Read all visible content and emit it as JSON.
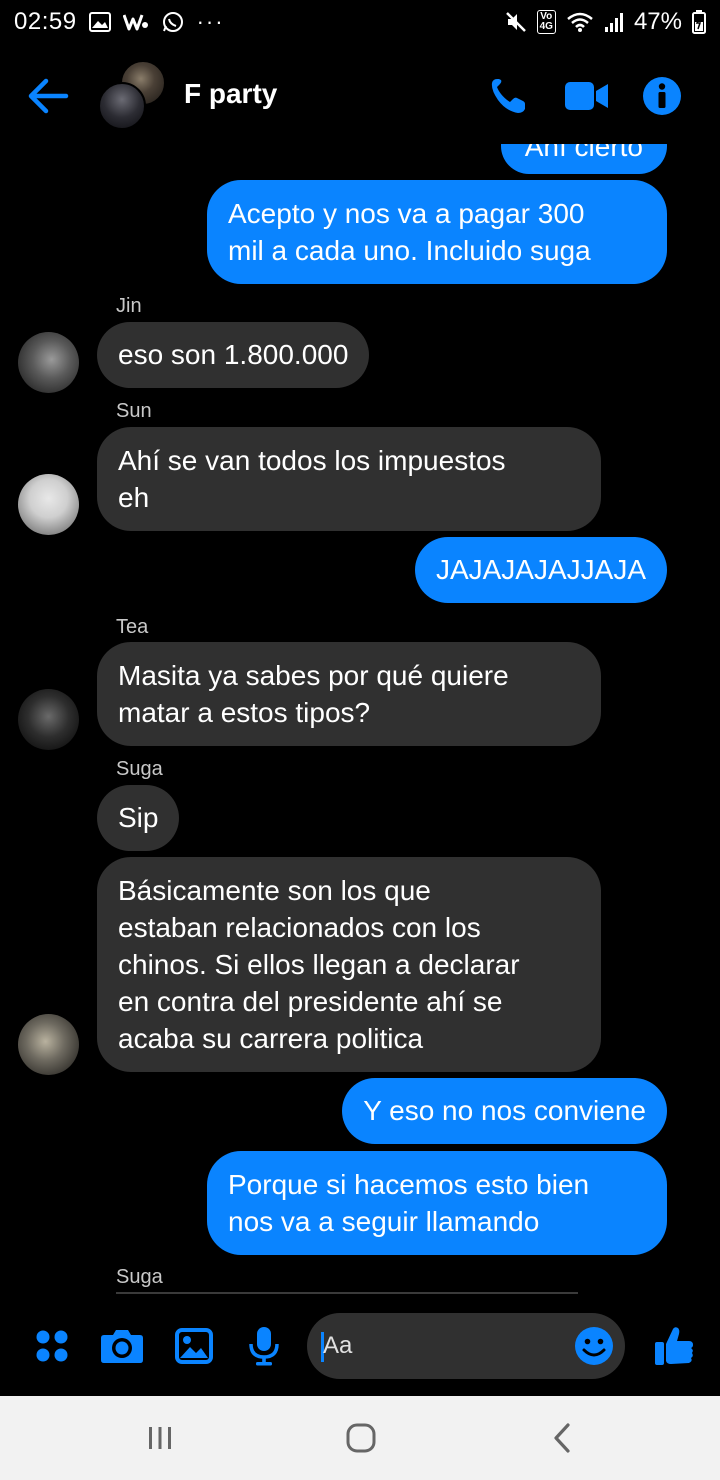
{
  "status_bar": {
    "time": "02:59",
    "battery": "47%",
    "network_badge_top": "Vo",
    "network_badge_bottom": "4G",
    "more": "···"
  },
  "header": {
    "title": "F party"
  },
  "colors": {
    "accent": "#0a84ff",
    "incoming_bubble": "#303030",
    "background": "#000000",
    "navbar": "#f2f2f2"
  },
  "messages": {
    "m0": {
      "text": "Ahí cierto"
    },
    "m1": {
      "line1": "Acepto y nos va a pagar 300",
      "line2": "mil a cada uno. Incluido suga"
    },
    "m2": {
      "sender": "Jin",
      "text": "eso son 1.800.000"
    },
    "m3": {
      "sender": "Sun",
      "line1": "Ahí se van todos los impuestos",
      "line2": "eh"
    },
    "m4": {
      "text": "JAJAJAJAJJAJA"
    },
    "m5": {
      "sender": "Tea",
      "line1": "Masita ya sabes por qué quiere",
      "line2": "matar a estos tipos?"
    },
    "m6": {
      "sender": "Suga",
      "text": "Sip"
    },
    "m7": {
      "line1": "Básicamente son los que",
      "line2": "estaban relacionados con los",
      "line3": "chinos. Si ellos llegan a declarar",
      "line4": "en contra del presidente ahí se",
      "line5": "acaba su carrera politica"
    },
    "m8": {
      "text": "Y eso no nos conviene"
    },
    "m9": {
      "line1": "Porque si hacemos esto bien",
      "line2": "nos va a seguir llamando"
    },
    "m10": {
      "sender": "Suga"
    }
  },
  "composer": {
    "placeholder": "Aa"
  },
  "icons": {
    "back": "arrow-left-icon",
    "call": "phone-icon",
    "video": "video-camera-icon",
    "info": "info-icon",
    "more": "four-dots-icon",
    "camera": "camera-icon",
    "gallery": "image-icon",
    "mic": "microphone-icon",
    "emoji": "smiley-icon",
    "like": "thumbs-up-icon"
  }
}
